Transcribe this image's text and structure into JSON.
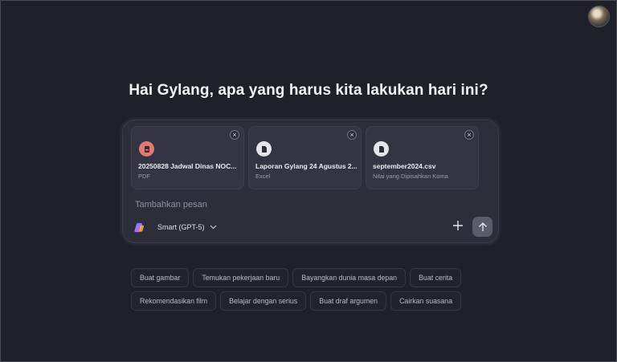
{
  "greeting": "Hai Gylang, apa yang harus kita lakukan hari ini?",
  "attachments": [
    {
      "name": "20250828 Jadwal Dinas NOC...",
      "type": "PDF",
      "icon": "pdf-file-icon",
      "color": "#e07a74"
    },
    {
      "name": "Laporan Gylang 24 Agustus 2...",
      "type": "Excel",
      "icon": "document-file-icon",
      "color": "#e6e6ea"
    },
    {
      "name": "september2024.csv",
      "type": "Nilai yang Dipisahkan Koma",
      "icon": "document-file-icon",
      "color": "#e6e6ea"
    }
  ],
  "composer": {
    "placeholder": "Tambahkan pesan",
    "model_label": "Smart (GPT-5)"
  },
  "suggestions": [
    "Buat gambar",
    "Temukan pekerjaan baru",
    "Bayangkan dunia masa depan",
    "Buat cerita",
    "Rekomendasikan film",
    "Belajar dengan serius",
    "Buat draf argumen",
    "Cairkan suasana"
  ],
  "colors": {
    "background": "#1f2029",
    "composer": "#2c2e3a",
    "send_button": "#5a5c6a"
  }
}
